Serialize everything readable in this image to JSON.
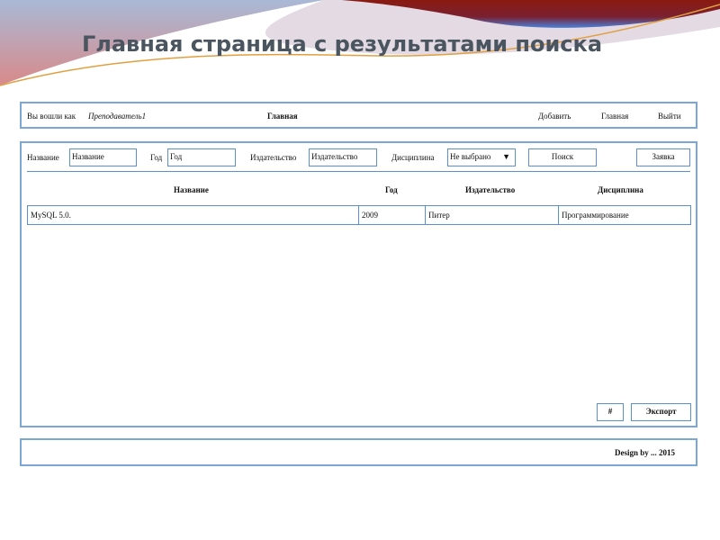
{
  "slide_title": "Главная страница с результатами поиска",
  "header": {
    "logged_in_label": "Вы вошли как",
    "user_link": "Преподаватель1",
    "page_name": "Главная",
    "nav": [
      "Добавить",
      "Главная",
      "Выйти"
    ]
  },
  "search": {
    "title_label": "Название",
    "title_value": "Название",
    "year_label": "Год",
    "year_value": "Год",
    "publisher_label": "Издательство",
    "publisher_value": "Издательство",
    "discipline_label": "Дисциплина",
    "discipline_value": "Не выбрано",
    "search_button": "Поиск",
    "request_button": "Заявка"
  },
  "table": {
    "headers": [
      "Название",
      "Год",
      "Издательство",
      "Дисциплина"
    ],
    "rows": [
      [
        "MySQL 5.0.",
        "2009",
        "Питер",
        "Программирование"
      ]
    ]
  },
  "actions": {
    "hash_button": "#",
    "export_button": "Экспорт"
  },
  "footer": {
    "text": "Design by ... 2015"
  }
}
